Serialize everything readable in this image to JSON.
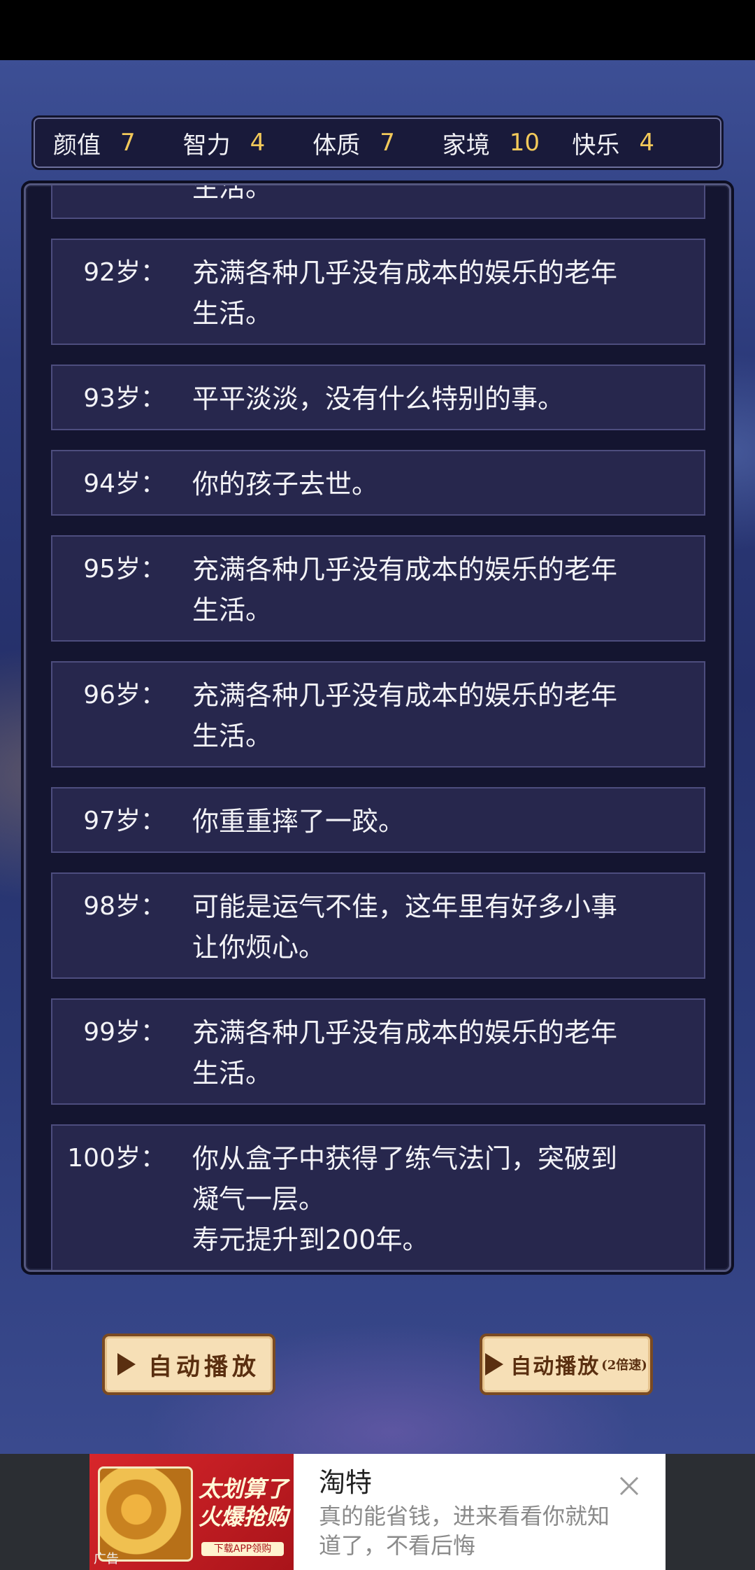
{
  "stats": [
    {
      "label": "颜值",
      "value": "7"
    },
    {
      "label": "智力",
      "value": "4"
    },
    {
      "label": "体质",
      "value": "7"
    },
    {
      "label": "家境",
      "value": "10"
    },
    {
      "label": "快乐",
      "value": "4"
    }
  ],
  "entries": [
    {
      "age": "",
      "text": "生活。"
    },
    {
      "age": "92岁：",
      "text": "充满各种几乎没有成本的娱乐的老年\n生活。"
    },
    {
      "age": "93岁：",
      "text": "平平淡淡，没有什么特别的事。"
    },
    {
      "age": "94岁：",
      "text": "你的孩子去世。"
    },
    {
      "age": "95岁：",
      "text": "充满各种几乎没有成本的娱乐的老年\n生活。"
    },
    {
      "age": "96岁：",
      "text": "充满各种几乎没有成本的娱乐的老年\n生活。"
    },
    {
      "age": "97岁：",
      "text": "你重重摔了一跤。"
    },
    {
      "age": "98岁：",
      "text": "可能是运气不佳，这年里有好多小事\n让你烦心。"
    },
    {
      "age": "99岁：",
      "text": "充满各种几乎没有成本的娱乐的老年\n生活。"
    },
    {
      "age": "100岁：",
      "text": "你从盒子中获得了练气法门，突破到\n凝气一层。\n寿元提升到200年。"
    }
  ],
  "buttons": {
    "autoplay": "自动播放",
    "autoplay_2x": "自动播放",
    "autoplay_2x_suffix": "(2倍速)"
  },
  "ad": {
    "headline": "太划算了火爆抢购",
    "small_button": "下载APP领购",
    "label": "广告",
    "title": "淘特",
    "description": "真的能省钱，进来看看你就知道了，不看后悔"
  }
}
